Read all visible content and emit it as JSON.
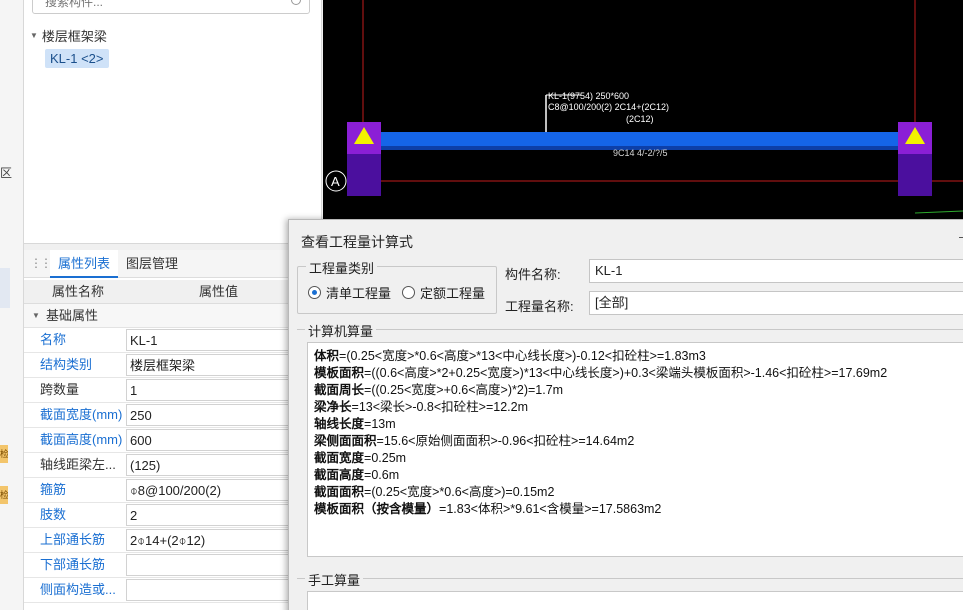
{
  "left_strip": {
    "fragment": "区",
    "tag_1": "检",
    "tag_2": "检"
  },
  "tree": {
    "search_placeholder": "搜索构件...",
    "parent_label": "楼层框架梁",
    "child_label": "KL-1 <2>"
  },
  "properties": {
    "tabs": [
      "属性列表",
      "图层管理"
    ],
    "header": {
      "name_col": "属性名称",
      "value_col": "属性值"
    },
    "group_label": "基础属性",
    "rows": [
      {
        "name": "名称",
        "value": "KL-1"
      },
      {
        "name": "结构类别",
        "value": "楼层框架梁"
      },
      {
        "name": "跨数量",
        "value": "1"
      },
      {
        "name": "截面宽度(mm)",
        "value": "250"
      },
      {
        "name": "截面高度(mm)",
        "value": "600"
      },
      {
        "name": "轴线距梁左...",
        "value": "(125)"
      },
      {
        "name": "箍筋",
        "value": "⌽8@100/200(2)"
      },
      {
        "name": "肢数",
        "value": "2"
      },
      {
        "name": "上部通长筋",
        "value": "2⌽14+(2⌽12)"
      },
      {
        "name": "下部通长筋",
        "value": ""
      },
      {
        "name": "侧面构造或...",
        "value": ""
      }
    ]
  },
  "canvas": {
    "beam_label_line1": "KL-1(9754) 250*600",
    "beam_label_line2": "C8@100/200(2) 2C14+(2C12)",
    "beam_label_line3": "(2C12)",
    "beam_bottom_label": "9C14 4/-2/?/5",
    "axis_marker": "A",
    "colors": {
      "beam": "#1565e8",
      "column": "#4b0f9e",
      "column_top": "#8b1fd6",
      "triangle": "#f2f200",
      "grid": "#c21b1b"
    }
  },
  "dialog": {
    "title": "查看工程量计算式",
    "type_group_label": "工程量类别",
    "radio_options": [
      "清单工程量",
      "定额工程量"
    ],
    "component_name_label": "构件名称:",
    "component_name_value": "KL-1",
    "quantity_name_label": "工程量名称:",
    "quantity_name_value": "[全部]",
    "computer_calc_label": "计算机算量",
    "calc_lines": [
      {
        "key": "体积",
        "expr": "=(0.25<宽度>*0.6<高度>*13<中心线长度>)-0.12<扣砼柱>=1.83m3"
      },
      {
        "key": "模板面积",
        "expr": "=((0.6<高度>*2+0.25<宽度>)*13<中心线长度>)+0.3<梁端头模板面积>-1.46<扣砼柱>=17.69m2"
      },
      {
        "key": "截面周长",
        "expr": "=((0.25<宽度>+0.6<高度>)*2)=1.7m"
      },
      {
        "key": "梁净长",
        "expr": "=13<梁长>-0.8<扣砼柱>=12.2m"
      },
      {
        "key": "轴线长度",
        "expr": "=13m"
      },
      {
        "key": "梁侧面面积",
        "expr": "=15.6<原始侧面面积>-0.96<扣砼柱>=14.64m2"
      },
      {
        "key": "截面宽度",
        "expr": "=0.25m"
      },
      {
        "key": "截面高度",
        "expr": "=0.6m"
      },
      {
        "key": "截面面积",
        "expr": "=(0.25<宽度>*0.6<高度>)=0.15m2"
      },
      {
        "key": "模板面积（按含模量）",
        "expr": "=1.83<体积>*9.61<含模量>=17.5863m2"
      }
    ],
    "manual_calc_label": "手工算量"
  }
}
